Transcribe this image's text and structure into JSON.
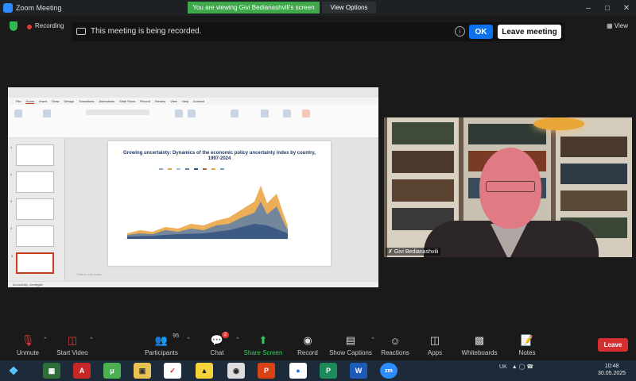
{
  "window": {
    "title": "Zoom Meeting",
    "viewing_banner": "You are viewing Givi Bedianashvili's screen",
    "view_options": "View Options"
  },
  "status": {
    "recording_label": "Recording",
    "view_label": "View"
  },
  "recording_notice": {
    "message": "This meeting is being recorded.",
    "ok_label": "OK",
    "leave_label": "Leave meeting"
  },
  "presentation": {
    "title": "Growing uncertainty: Dynamics of the economic policy uncertainty index by country, 1997-2024",
    "notes_placeholder": "Click to add notes",
    "tabs": [
      "File",
      "Home",
      "Insert",
      "Draw",
      "Design",
      "Transitions",
      "Animations",
      "Slide Show",
      "Record",
      "Review",
      "View",
      "Help",
      "Acrobat"
    ],
    "active_tab": "Home",
    "accessibility": "Accessibility: Investigate"
  },
  "video": {
    "participant_name": "Givi Bedianashvili"
  },
  "toolbar": {
    "unmute": "Unmute",
    "start_video": "Start Video",
    "participants": "Participants",
    "participants_count": "95",
    "chat": "Chat",
    "chat_badge": "2",
    "share_screen": "Share Screen",
    "record": "Record",
    "show_captions": "Show Captions",
    "reactions": "Reactions",
    "apps": "Apps",
    "whiteboards": "Whiteboards",
    "notes": "Notes",
    "leave": "Leave"
  },
  "taskbar": {
    "language": "UK",
    "time": "10:48",
    "date": "30.05.2025"
  },
  "colors": {
    "accent_blue": "#0e72ed",
    "share_green": "#2fd15a",
    "leave_red": "#d32f2f",
    "recording_red": "#e53935"
  }
}
